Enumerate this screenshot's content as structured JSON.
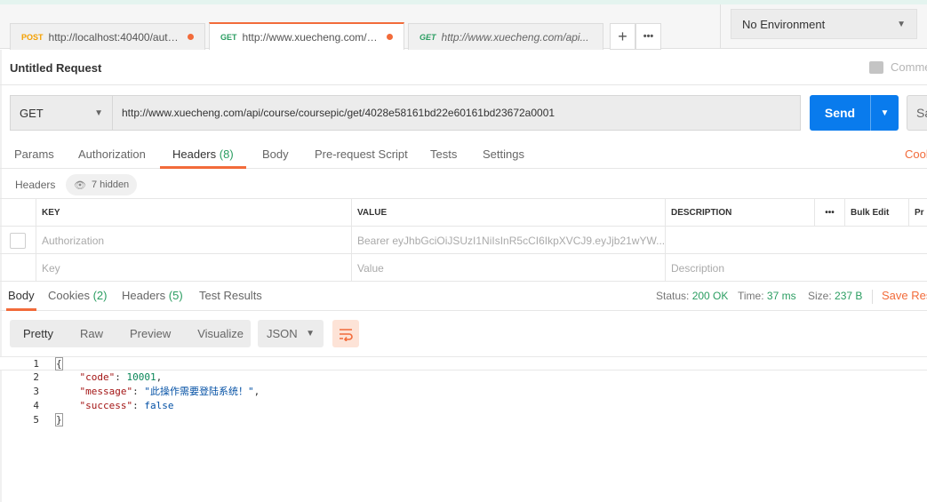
{
  "tabs": [
    {
      "method": "POST",
      "url": "http://localhost:40400/auth/o...",
      "unsaved": true,
      "active": false
    },
    {
      "method": "GET",
      "url": "http://www.xuecheng.com/api/...",
      "unsaved": true,
      "active": true
    },
    {
      "method": "GET",
      "url": "http://www.xuecheng.com/api...",
      "unsaved": false,
      "active": false
    }
  ],
  "tab_buttons": {
    "add": "+",
    "more": "•••"
  },
  "environment": {
    "selected": "No Environment"
  },
  "request": {
    "title": "Untitled Request",
    "comments_label": "Comme",
    "method": "GET",
    "url": "http://www.xuecheng.com/api/course/coursepic/get/4028e58161bd22e60161bd23672a0001",
    "send_label": "Send",
    "save_label": "Sa"
  },
  "request_tabs": [
    {
      "label": "Params",
      "count": ""
    },
    {
      "label": "Authorization",
      "count": ""
    },
    {
      "label": "Headers",
      "count": "(8)"
    },
    {
      "label": "Body",
      "count": ""
    },
    {
      "label": "Pre-request Script",
      "count": ""
    },
    {
      "label": "Tests",
      "count": ""
    },
    {
      "label": "Settings",
      "count": ""
    }
  ],
  "cookies_link": "Cook",
  "headers": {
    "label": "Headers",
    "hidden_badge": "7 hidden",
    "columns": {
      "key": "KEY",
      "value": "VALUE",
      "description": "DESCRIPTION"
    },
    "more": "•••",
    "bulk_edit": "Bulk Edit",
    "presets": "Pr",
    "rows": [
      {
        "key": "Authorization",
        "value": "Bearer eyJhbGciOiJSUzI1NiIsInR5cCI6IkpXVCJ9.eyJjb21wYW...",
        "description": ""
      }
    ],
    "placeholder": {
      "key": "Key",
      "value": "Value",
      "description": "Description"
    }
  },
  "response_tabs": [
    {
      "label": "Body",
      "count": ""
    },
    {
      "label": "Cookies",
      "count": "(2)"
    },
    {
      "label": "Headers",
      "count": "(5)"
    },
    {
      "label": "Test Results",
      "count": ""
    }
  ],
  "response_meta": {
    "status_label": "Status:",
    "status": "200 OK",
    "time_label": "Time:",
    "time": "37 ms",
    "size_label": "Size:",
    "size": "237 B",
    "save_response": "Save Res"
  },
  "view_modes": [
    "Pretty",
    "Raw",
    "Preview",
    "Visualize"
  ],
  "format": "JSON",
  "code_lines": [
    {
      "n": "1",
      "tokens": [
        {
          "t": "{",
          "c": "brace"
        }
      ]
    },
    {
      "n": "2",
      "tokens": [
        {
          "t": "    ",
          "c": ""
        },
        {
          "t": "\"code\"",
          "c": "tok-key"
        },
        {
          "t": ": ",
          "c": ""
        },
        {
          "t": "10001",
          "c": "tok-num"
        },
        {
          "t": ",",
          "c": ""
        }
      ]
    },
    {
      "n": "3",
      "tokens": [
        {
          "t": "    ",
          "c": ""
        },
        {
          "t": "\"message\"",
          "c": "tok-key"
        },
        {
          "t": ": ",
          "c": ""
        },
        {
          "t": "\"此操作需要登陆系统！\"",
          "c": "tok-str"
        },
        {
          "t": ",",
          "c": ""
        }
      ]
    },
    {
      "n": "4",
      "tokens": [
        {
          "t": "    ",
          "c": ""
        },
        {
          "t": "\"success\"",
          "c": "tok-key"
        },
        {
          "t": ": ",
          "c": ""
        },
        {
          "t": "false",
          "c": "tok-bool"
        }
      ]
    },
    {
      "n": "5",
      "tokens": [
        {
          "t": "}",
          "c": "brace"
        }
      ]
    }
  ]
}
